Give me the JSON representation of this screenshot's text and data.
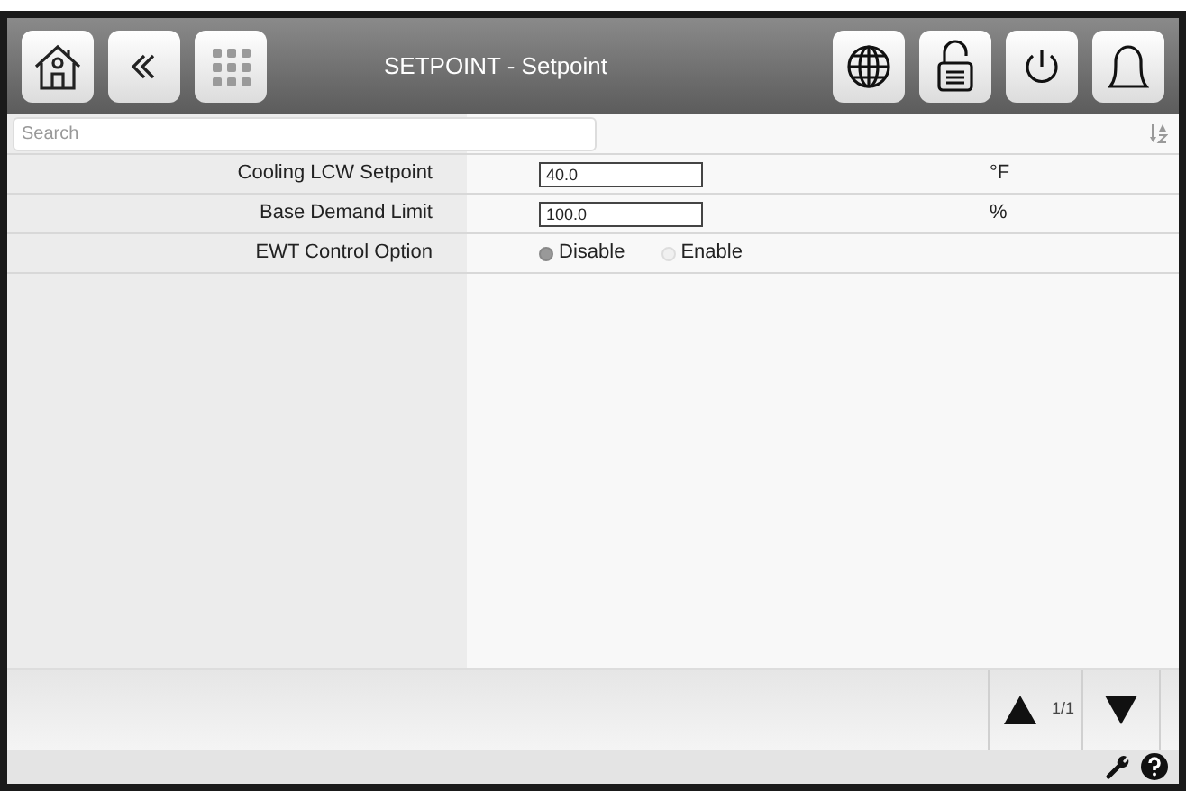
{
  "header": {
    "title": "SETPOINT - Setpoint"
  },
  "search": {
    "placeholder": "Search"
  },
  "rows": [
    {
      "kind": "input",
      "label": "Cooling LCW Setpoint",
      "value": "40.0",
      "unit": "°F"
    },
    {
      "kind": "input",
      "label": "Base Demand Limit",
      "value": "100.0",
      "unit": "%"
    },
    {
      "kind": "radio",
      "label": "EWT Control Option",
      "options": [
        {
          "label": "Disable",
          "selected": true
        },
        {
          "label": "Enable",
          "selected": false
        }
      ]
    }
  ],
  "pager": {
    "page": "1/1"
  }
}
